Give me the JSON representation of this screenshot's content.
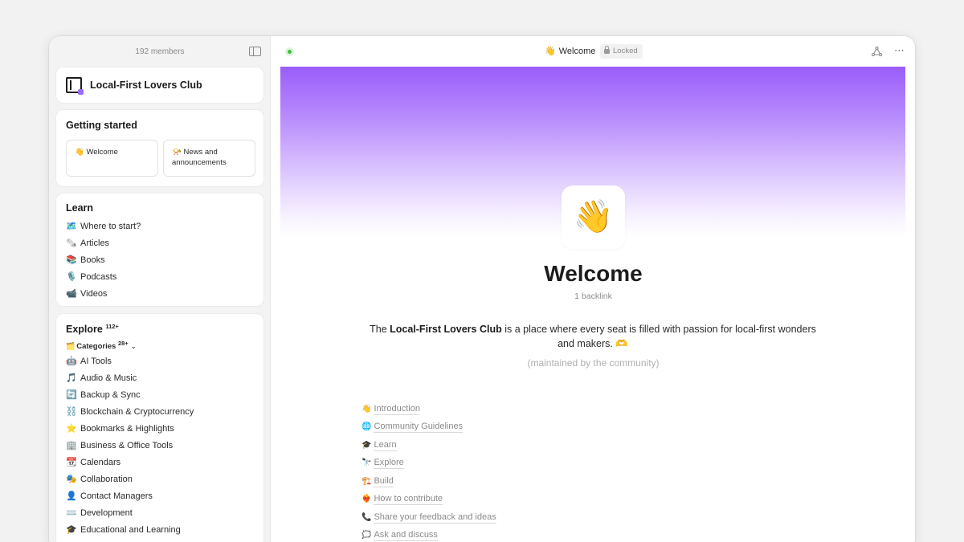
{
  "sidebar": {
    "members": "192 members",
    "club_name": "Local-First Lovers Club",
    "getting_started": {
      "title": "Getting started",
      "tiles": [
        {
          "emoji": "👋",
          "label": "Welcome"
        },
        {
          "emoji": "📯",
          "label": "News and announcements"
        }
      ]
    },
    "learn": {
      "title": "Learn",
      "items": [
        {
          "emoji": "🗺️",
          "label": "Where to start?"
        },
        {
          "emoji": "🗞️",
          "label": "Articles"
        },
        {
          "emoji": "📚",
          "label": "Books"
        },
        {
          "emoji": "🎙️",
          "label": "Podcasts"
        },
        {
          "emoji": "📹",
          "label": "Videos"
        }
      ]
    },
    "explore": {
      "title": "Explore",
      "count": "112+",
      "categories_emoji": "🗂️",
      "categories_label": "Categories",
      "categories_count": "28+",
      "categories_chevron": "⌄",
      "items": [
        {
          "emoji": "🤖",
          "label": "AI Tools"
        },
        {
          "emoji": "🎵",
          "label": "Audio & Music"
        },
        {
          "emoji": "🔄",
          "label": "Backup & Sync"
        },
        {
          "emoji": "⛓️",
          "label": "Blockchain & Cryptocurrency"
        },
        {
          "emoji": "⭐",
          "label": "Bookmarks & Highlights"
        },
        {
          "emoji": "🏢",
          "label": "Business & Office Tools"
        },
        {
          "emoji": "📆",
          "label": "Calendars"
        },
        {
          "emoji": "🎭",
          "label": "Collaboration"
        },
        {
          "emoji": "👤",
          "label": "Contact Managers"
        },
        {
          "emoji": "⌨️",
          "label": "Development"
        },
        {
          "emoji": "🎓",
          "label": "Educational and Learning"
        }
      ]
    }
  },
  "topbar": {
    "page_emoji": "👋",
    "page_name": "Welcome",
    "locked_label": "Locked"
  },
  "page": {
    "icon": "👋",
    "title": "Welcome",
    "backlinks": "1 backlink",
    "intro_before": "The ",
    "intro_bold": "Local-First Lovers Club",
    "intro_after": " is a place where every seat is filled with passion for local-first wonders and makers. 🫶",
    "maintained": "(maintained by the community)",
    "toc": [
      {
        "emoji": "👋",
        "label": "Introduction"
      },
      {
        "emoji": "🌐",
        "label": "Community Guidelines"
      },
      {
        "emoji": "🎓",
        "label": "Learn"
      },
      {
        "emoji": "🔭",
        "label": "Explore"
      },
      {
        "emoji": "🏗️",
        "label": "Build"
      },
      {
        "emoji": "❤️‍🔥",
        "label": "How to contribute"
      },
      {
        "emoji": "📞",
        "label": "Share your feedback and ideas"
      },
      {
        "emoji": "🗯️",
        "label": "Ask and discuss"
      }
    ]
  },
  "colors": {
    "banner_top": "#9a5dfb",
    "status_green": "#38c13a",
    "accent_purple": "#9b6bff"
  }
}
